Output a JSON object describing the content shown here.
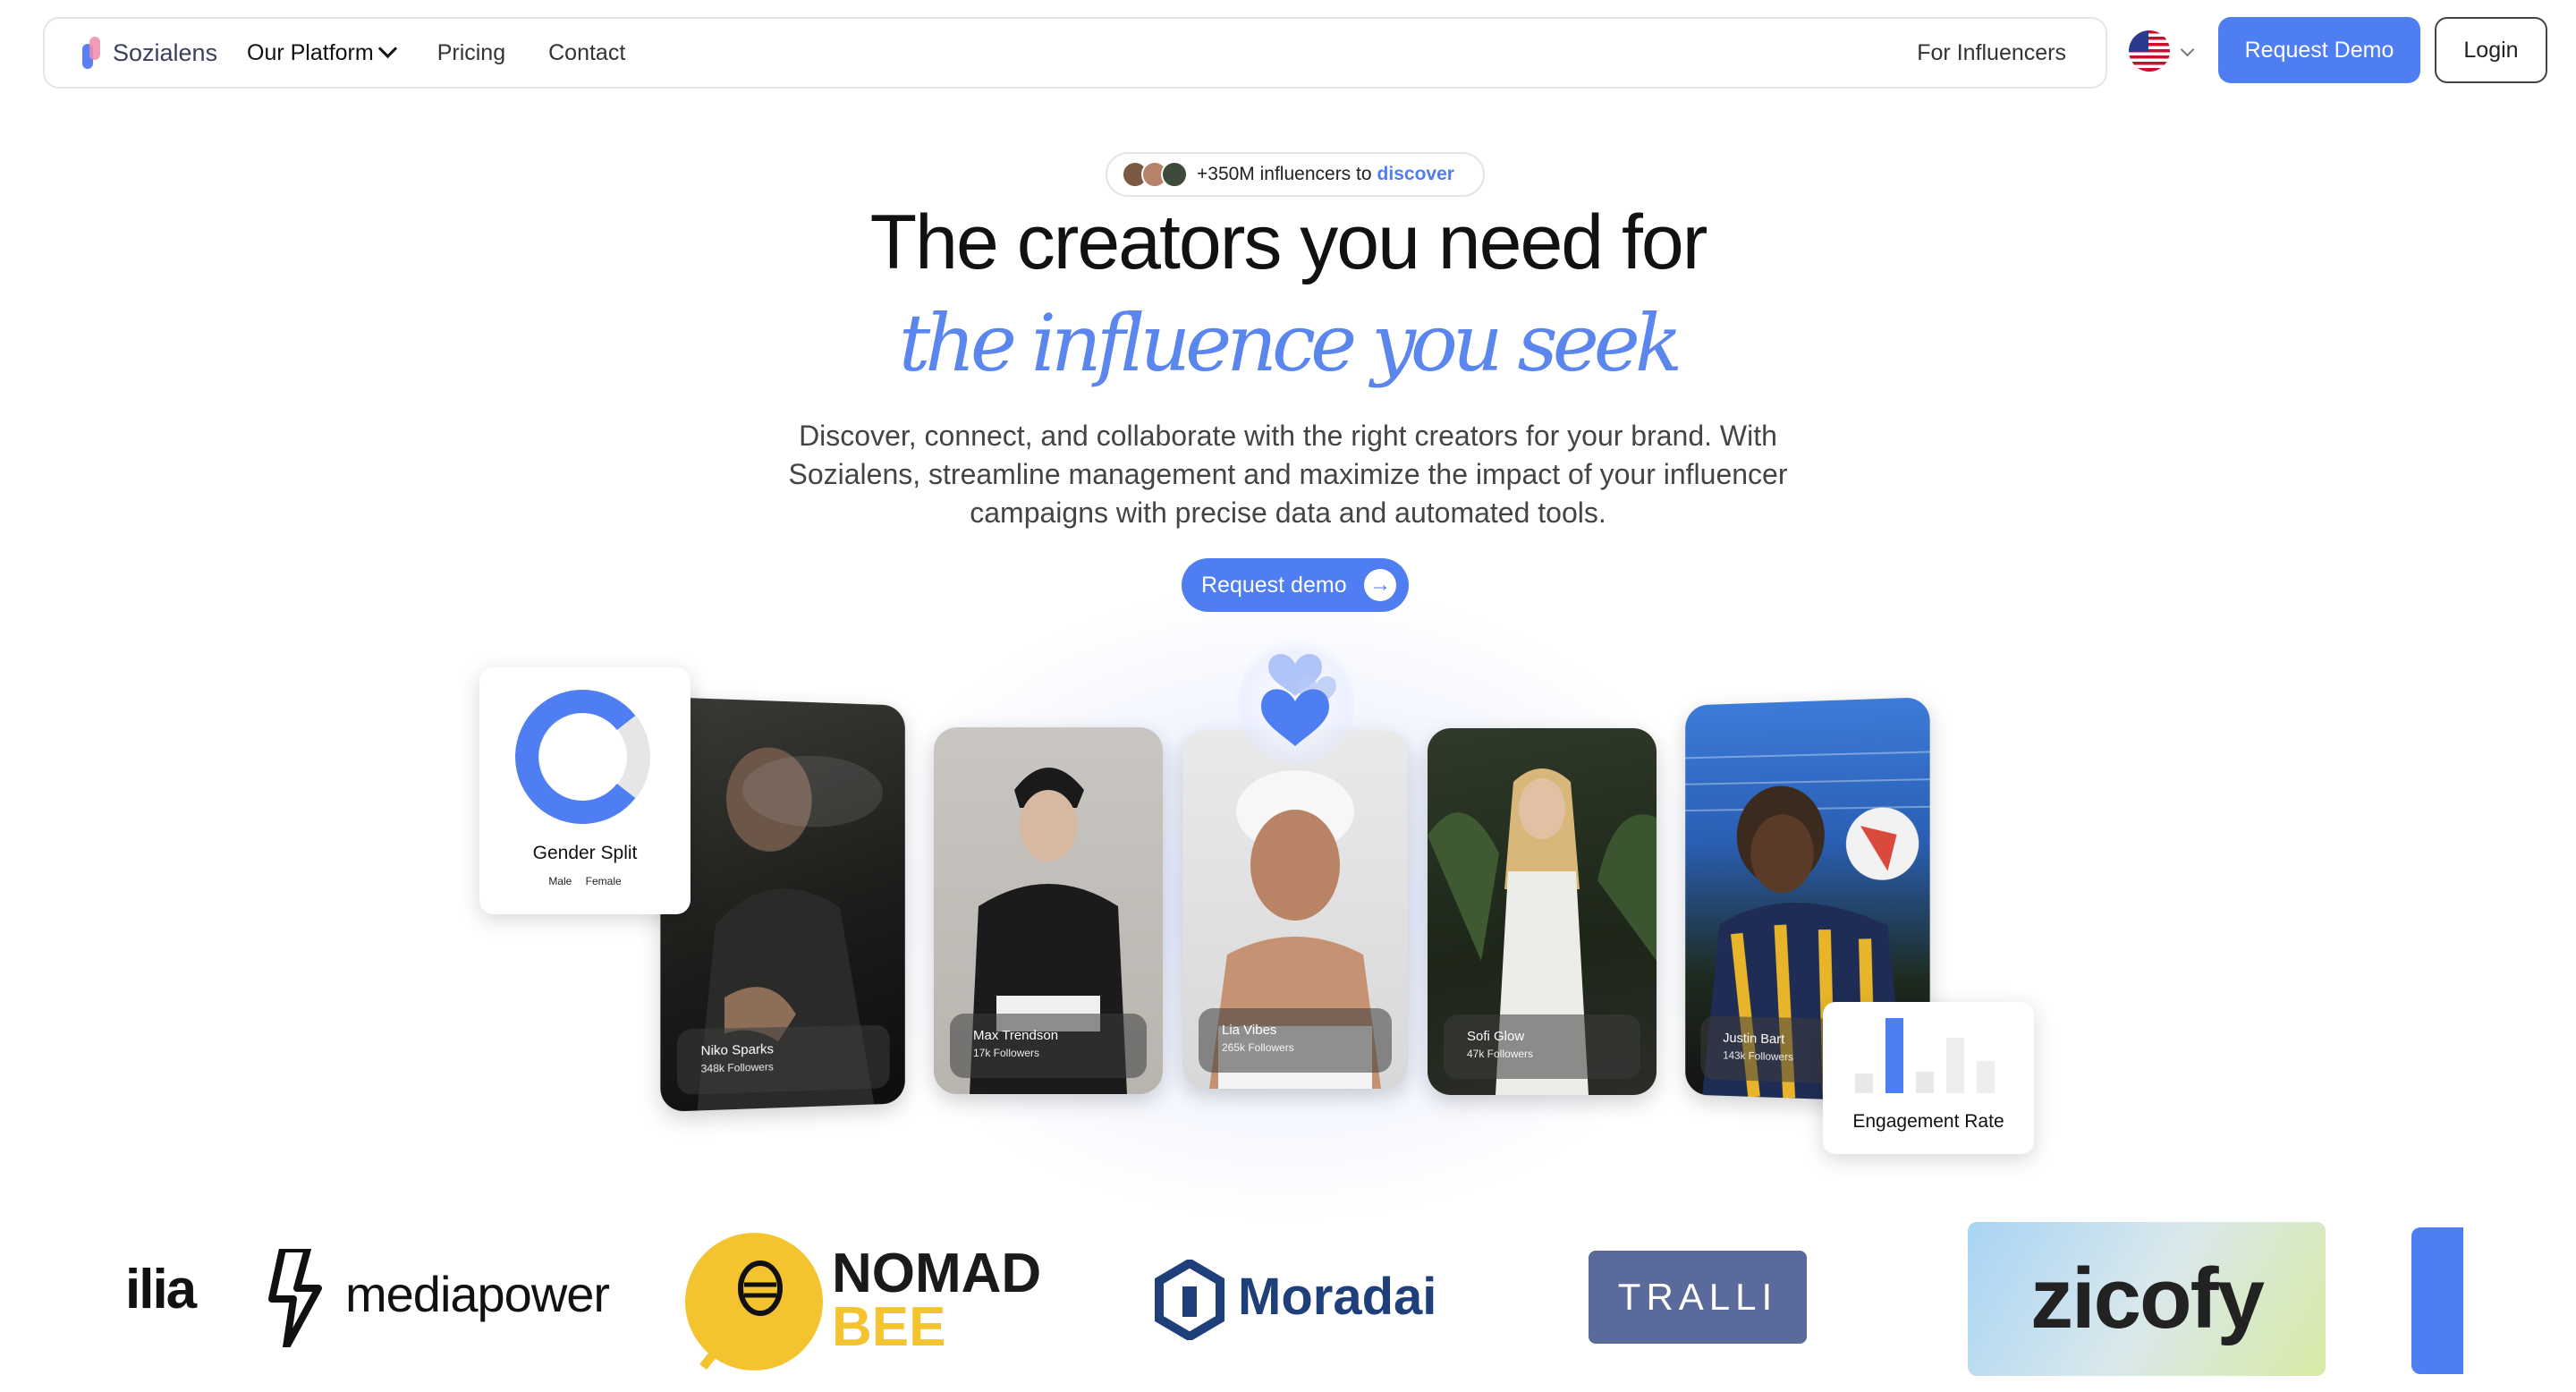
{
  "nav": {
    "brand": "Sozialens",
    "links": [
      {
        "label": "Our Platform"
      },
      {
        "label": "Pricing"
      },
      {
        "label": "Contact"
      }
    ],
    "for_influencers": "For Influencers",
    "request_demo": "Request Demo",
    "login": "Login"
  },
  "hero": {
    "pill_text": "+350M influencers to",
    "pill_highlight": "discover",
    "title_line1": "The creators you need for",
    "title_line2": "the influence you seek",
    "subtitle": "Discover, connect, and collaborate with the right creators for your brand. With Sozialens, streamline management and maximize the impact of your influencer campaigns with precise data and automated tools.",
    "cta": "Request demo"
  },
  "creators": [
    {
      "name": "Niko Sparks",
      "followers": "348k Followers"
    },
    {
      "name": "Max Trendson",
      "followers": "17k Followers"
    },
    {
      "name": "Lia Vibes",
      "followers": "265k Followers"
    },
    {
      "name": "Sofi Glow",
      "followers": "47k Followers"
    },
    {
      "name": "Justin Bart",
      "followers": "143k Followers"
    }
  ],
  "widgets": {
    "gender_title": "Gender Split",
    "gender_male": "Male",
    "gender_female": "Female",
    "engagement_title": "Engagement Rate"
  },
  "logos": [
    "ilia",
    "mediapower",
    "NOMAD",
    "BEE",
    "Moradai",
    "TRALLI",
    "zicofy"
  ],
  "colors": {
    "accent": "#4f7ef2",
    "accent_script": "#5b86ee"
  }
}
